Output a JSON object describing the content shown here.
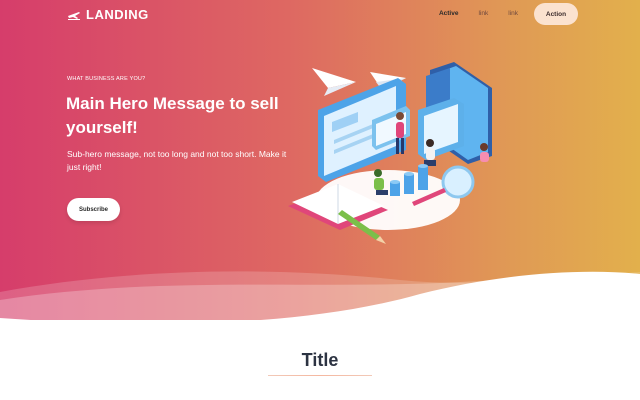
{
  "brand": {
    "name": "LANDING",
    "icon": "plane-icon"
  },
  "nav": {
    "links": [
      "Active",
      "link",
      "link"
    ],
    "action_label": "Action"
  },
  "hero": {
    "eyebrow": "WHAT BUSINESS ARE YOU?",
    "headline": "Main Hero Message to sell yourself!",
    "subtext": "Sub-hero message, not too long and not too short. Make it just right!",
    "cta_label": "Subscribe",
    "illustration": "isometric-workspace-illustration"
  },
  "section": {
    "title": "Title"
  },
  "colors": {
    "gradient_start": "#d63d6b",
    "gradient_end": "#e2b04c",
    "heading": "#2c3342",
    "action_bg": "#fbe2cf"
  }
}
